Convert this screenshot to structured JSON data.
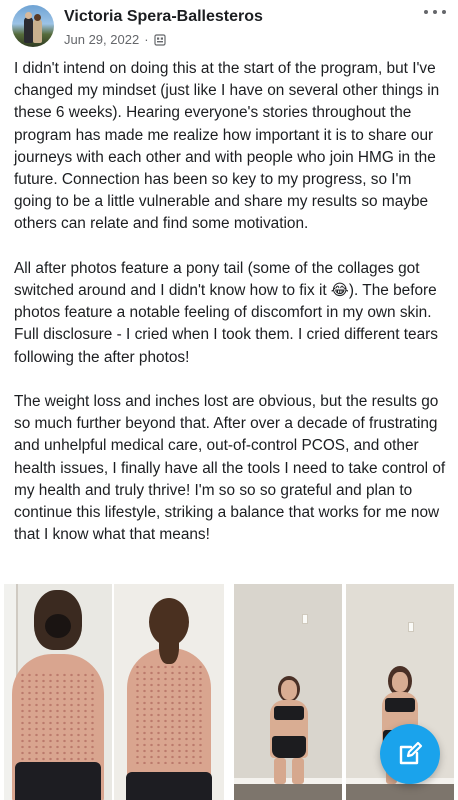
{
  "post": {
    "author": "Victoria Spera-Ballesteros",
    "date": "Jun 29, 2022",
    "separator": "·",
    "paragraphs": [
      "I didn't intend on doing this at the start of the program, but I've changed my mindset (just like I have on several other things in these 6 weeks). Hearing everyone's stories throughout the program has made me realize how important it is to share our journeys with each other and with people who join HMG in the future. Connection has been so key to my progress, so I'm going to be a little vulnerable and share my results so maybe others can relate and find some motivation.",
      "All after photos feature a pony tail (some of the collages got switched around and I didn't know how to fix it 😂). The before photos feature a notable feeling of discomfort in my own skin. Full disclosure - I cried when I took them. I cried different tears following the after photos!",
      "The weight loss and inches lost are obvious, but the results go so much further beyond that. After over a decade of frustrating and unhelpful medical care, out-of-control PCOS, and other health issues, I finally have all the tools I need to take control of my health and truly thrive! I'm so so so grateful and plan to continue this lifestyle, striking a balance that works for me now that I know what that means!"
    ]
  },
  "icons": {
    "more": "more-options-icon",
    "audience": "group-audience-icon",
    "compose": "compose-edit-icon"
  },
  "colors": {
    "text": "#1c1e21",
    "meta": "#65676b",
    "fab": "#1aa3ec"
  }
}
